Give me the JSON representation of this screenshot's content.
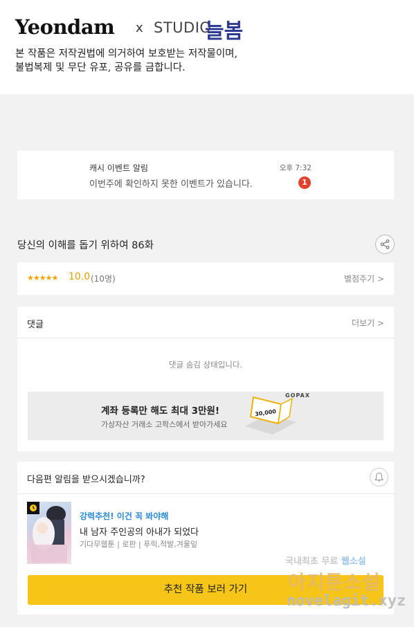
{
  "header": {
    "brand": "Yeondam",
    "separator": "x",
    "studio": "STUDIO",
    "studio_korean": "늘봄",
    "copyright_line1": "본 작품은 저작권법에 의거하여 보호받는 저작물이며,",
    "copyright_line2": "불법복제 및 무단 유포, 공유를 금합니다."
  },
  "notification": {
    "title": "캐시 이벤트 알림",
    "message": "이번주에 확인하지 못한 이벤트가 있습니다.",
    "time": "오후 7:32",
    "badge_count": "1"
  },
  "episode": {
    "title": "당신의 이해를 돕기 위하여 86화",
    "share_icon": "share-icon"
  },
  "rating": {
    "stars": "★★★★★",
    "score": "10.0",
    "count": "(10명)",
    "rate_link": "별점주기 >"
  },
  "comments": {
    "header": "댓글",
    "more_link": "더보기 >",
    "hidden_message": "댓글 숨김 상태입니다."
  },
  "ad": {
    "title": "계좌 등록만 해도 최대 3만원!",
    "subtitle": "가상자산 거래소 고팍스에서 받아가세요",
    "brand": "GOPAX",
    "amount": "30,000"
  },
  "notify": {
    "question": "다음편 알림을 받으시겠습니까?",
    "bell_icon": "bell-icon"
  },
  "recommendation": {
    "tag": "강력추천! 이건 꼭 봐야해",
    "title": "내 남자 주인공의 아내가 되었다",
    "meta": "기다무웹툰 | 로판 | 푸릭,적발,겨울잎",
    "button_label": "추천 작품 보러 가기"
  },
  "watermark": {
    "line1_a": "국내최초 무료 ",
    "line1_b": "웹소설",
    "line2": "아지툰소설",
    "line3": "novelagit.xyz"
  },
  "colors": {
    "accent_yellow": "#f6c518",
    "star": "#f0a200",
    "badge_red": "#e1412d",
    "studio_blue": "#2f3b93",
    "tag_blue": "#2a8ad8"
  }
}
